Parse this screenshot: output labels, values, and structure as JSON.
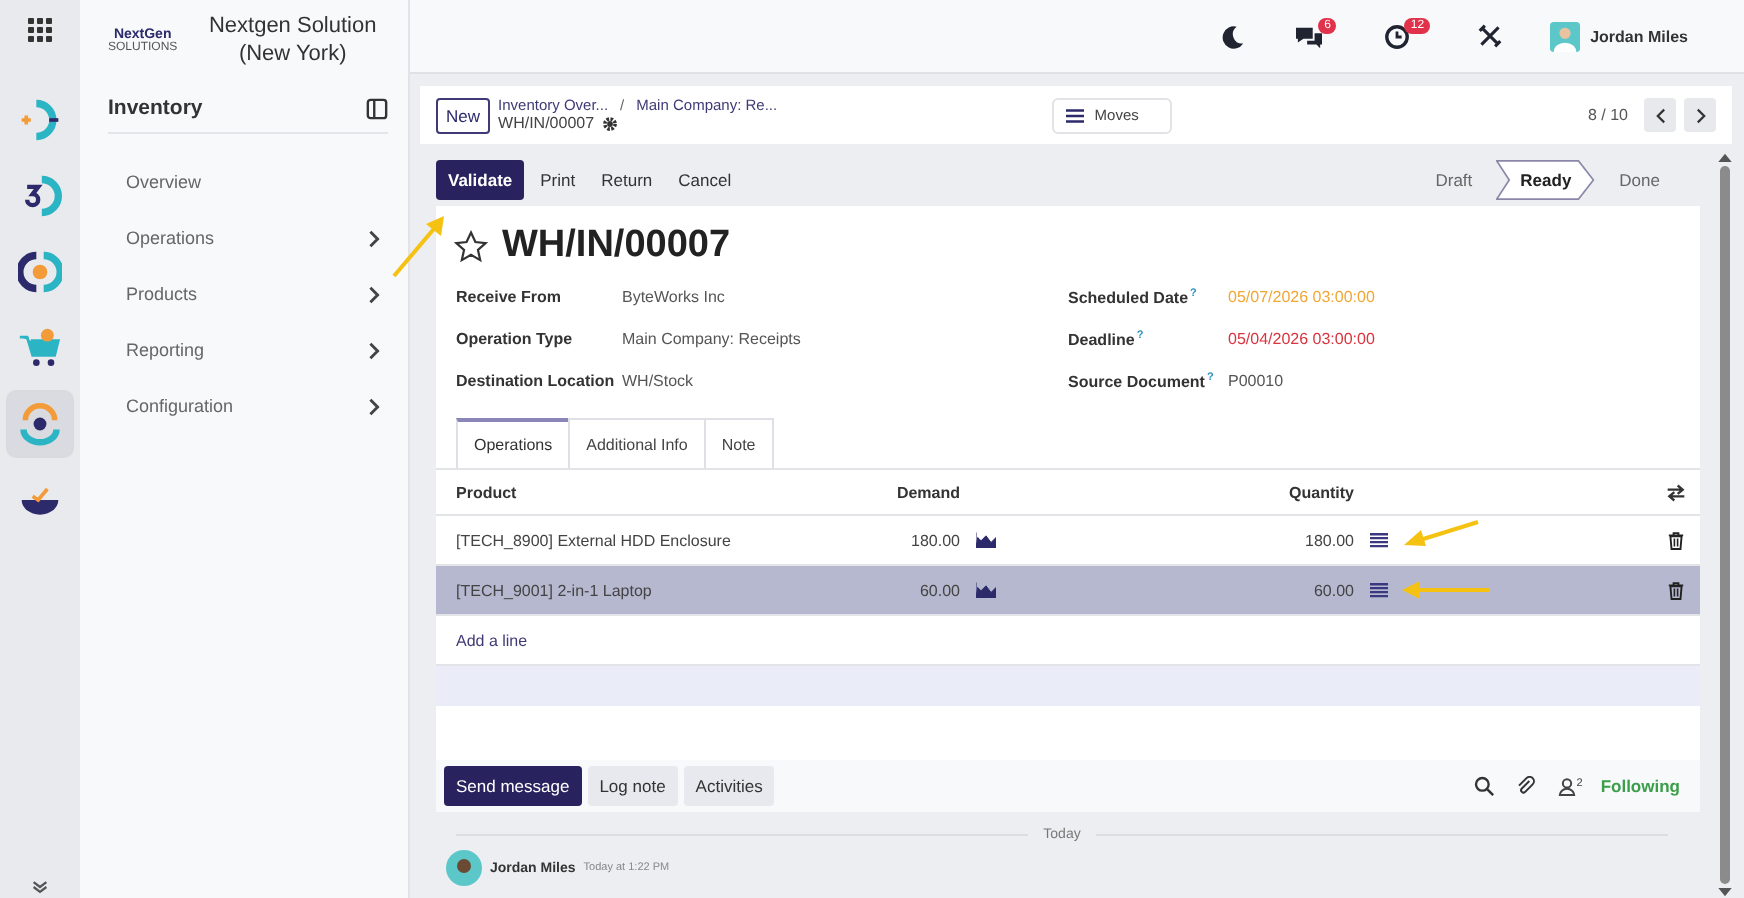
{
  "company": {
    "logo_text": "NextGen",
    "logo_subtext": "SOLUTIONS",
    "name": "Nextgen Solution (New York)"
  },
  "sidebar": {
    "title": "Inventory",
    "items": [
      {
        "label": "Overview",
        "has_children": false
      },
      {
        "label": "Operations",
        "has_children": true
      },
      {
        "label": "Products",
        "has_children": true
      },
      {
        "label": "Reporting",
        "has_children": true
      },
      {
        "label": "Configuration",
        "has_children": true
      }
    ]
  },
  "topbar": {
    "chat_badge": "6",
    "activity_badge": "12",
    "user_name": "Jordan Miles"
  },
  "control_panel": {
    "new_button": "New",
    "breadcrumbs": [
      "Inventory Over...",
      "Main Company: Re..."
    ],
    "breadcrumb_separator": "/",
    "record_name": "WH/IN/00007",
    "moves_button": "Moves",
    "pager": "8 / 10"
  },
  "actions": [
    {
      "label": "Validate",
      "primary": true
    },
    {
      "label": "Print",
      "primary": false
    },
    {
      "label": "Return",
      "primary": false
    },
    {
      "label": "Cancel",
      "primary": false
    }
  ],
  "status_steps": [
    {
      "label": "Draft",
      "selected": false
    },
    {
      "label": "Ready",
      "selected": true
    },
    {
      "label": "Done",
      "selected": false
    }
  ],
  "record": {
    "title": "WH/IN/00007",
    "starred": false
  },
  "fields_left": [
    {
      "label": "Receive From",
      "value": "ByteWorks Inc"
    },
    {
      "label": "Operation Type",
      "value": "Main Company: Receipts"
    },
    {
      "label": "Destination Location",
      "value": "WH/Stock"
    }
  ],
  "fields_right": [
    {
      "label": "Scheduled Date",
      "help": "?",
      "value": "05/07/2026 03:00:00",
      "color": "#f0a733"
    },
    {
      "label": "Deadline",
      "help": "?",
      "value": "05/04/2026 03:00:00",
      "color": "#d9343f"
    },
    {
      "label": "Source Document",
      "help": "?",
      "value": "P00010",
      "color": "#555555"
    }
  ],
  "tabs": [
    {
      "label": "Operations",
      "selected": true
    },
    {
      "label": "Additional Info",
      "selected": false
    },
    {
      "label": "Note",
      "selected": false
    }
  ],
  "table": {
    "columns": [
      "Product",
      "Demand",
      "Quantity"
    ],
    "rows": [
      {
        "product": "[TECH_8900] External HDD Enclosure",
        "demand": "180.00",
        "quantity": "180.00",
        "selected": false
      },
      {
        "product": "[TECH_9001] 2-in-1 Laptop",
        "demand": "60.00",
        "quantity": "60.00",
        "selected": true
      }
    ],
    "add_line": "Add a line"
  },
  "chatter": {
    "buttons": [
      {
        "label": "Send message",
        "primary": true
      },
      {
        "label": "Log note",
        "primary": false
      },
      {
        "label": "Activities",
        "primary": false
      }
    ],
    "follower_count": "2",
    "following": "Following"
  },
  "separator": "Today",
  "message": {
    "author": "Jordan Miles",
    "time": "Today at 1:22 PM"
  }
}
